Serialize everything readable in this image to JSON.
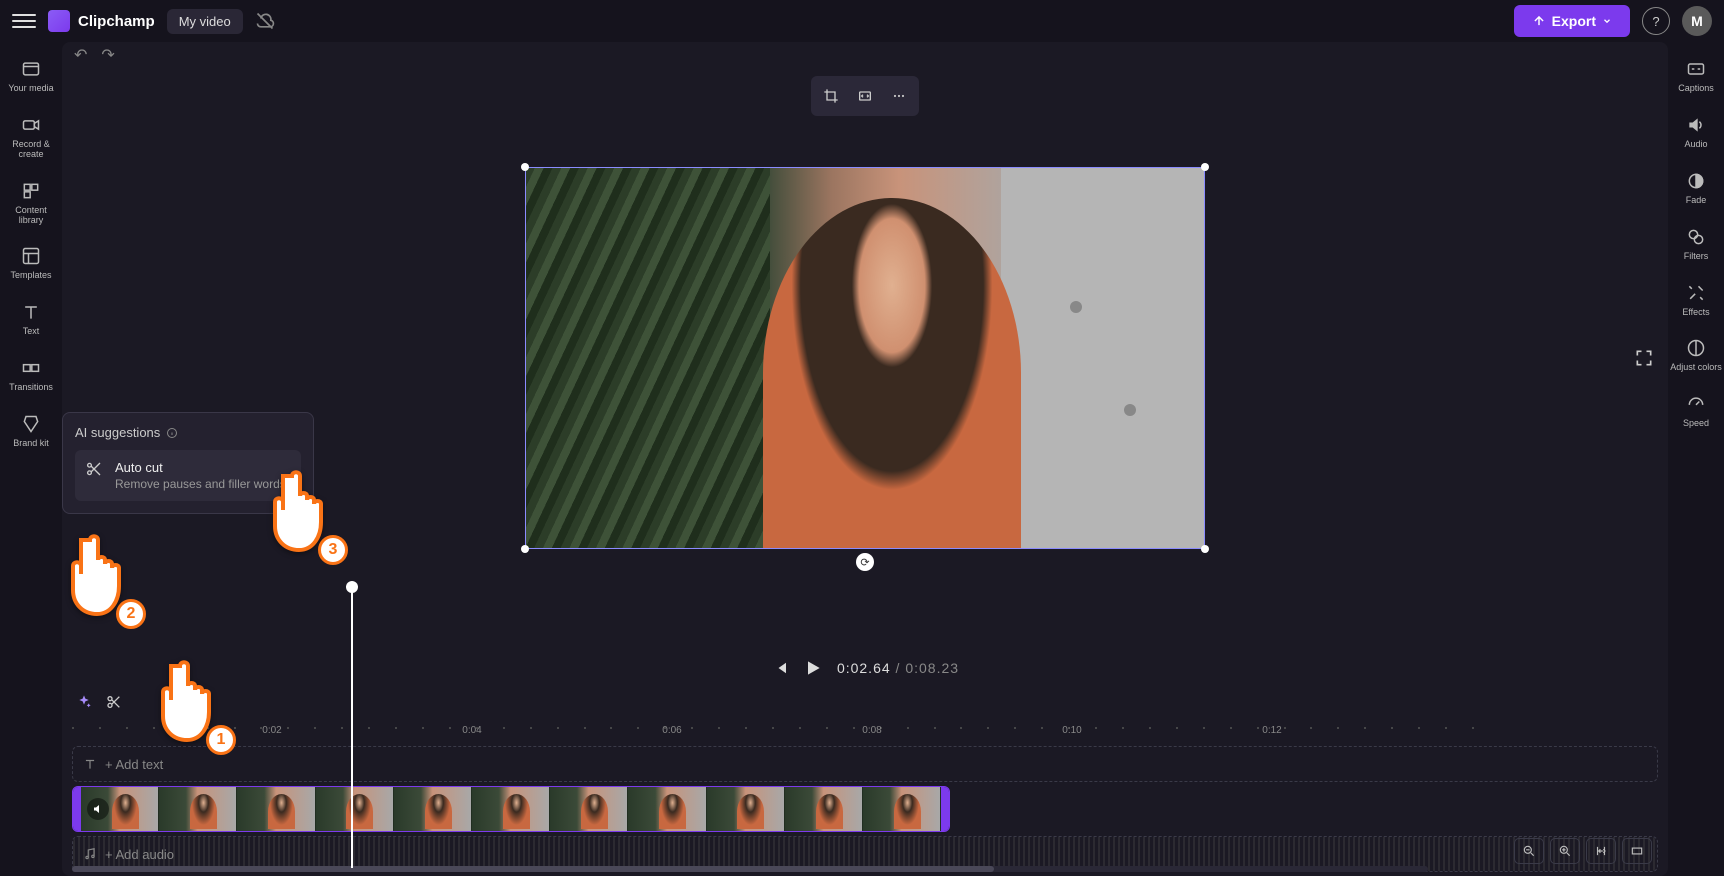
{
  "app": {
    "name": "Clipchamp",
    "project": "My video",
    "export_label": "Export",
    "avatar_initial": "M"
  },
  "left_rail": [
    {
      "id": "your-media",
      "label": "Your media"
    },
    {
      "id": "record-create",
      "label": "Record & create"
    },
    {
      "id": "content-library",
      "label": "Content library"
    },
    {
      "id": "templates",
      "label": "Templates"
    },
    {
      "id": "text",
      "label": "Text"
    },
    {
      "id": "transitions",
      "label": "Transitions"
    },
    {
      "id": "brand-kit",
      "label": "Brand kit"
    }
  ],
  "right_rail": [
    {
      "id": "captions",
      "label": "Captions"
    },
    {
      "id": "audio",
      "label": "Audio"
    },
    {
      "id": "fade",
      "label": "Fade"
    },
    {
      "id": "filters",
      "label": "Filters"
    },
    {
      "id": "effects",
      "label": "Effects"
    },
    {
      "id": "adjust-colors",
      "label": "Adjust colors"
    },
    {
      "id": "speed",
      "label": "Speed"
    }
  ],
  "playback": {
    "current": "0:02.64",
    "duration": "0:08.23"
  },
  "timeline": {
    "ruler": [
      "0:02",
      "0:04",
      "0:06",
      "0:08",
      "0:10",
      "0:12"
    ],
    "text_track_placeholder": "+ Add text",
    "audio_track_placeholder": "+ Add audio"
  },
  "ai_popup": {
    "title": "AI suggestions",
    "item_title": "Auto cut",
    "item_sub": "Remove pauses and filler words"
  },
  "annotations": {
    "one": "1",
    "two": "2",
    "three": "3"
  }
}
